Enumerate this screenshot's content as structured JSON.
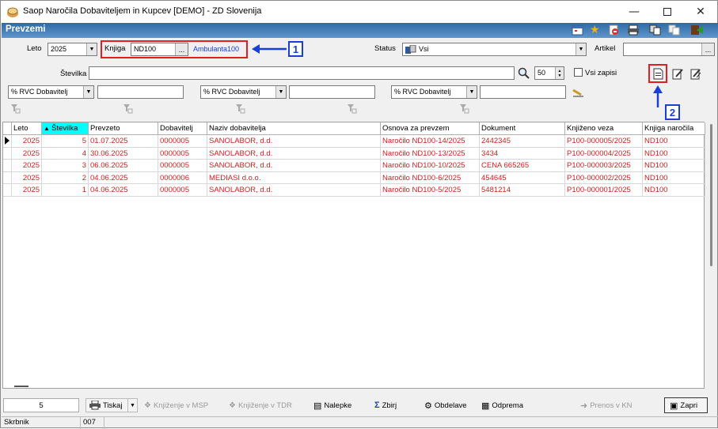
{
  "window": {
    "title": "Saop  Naročila Dobaviteljem in Kupcev [DEMO] - ZD Slovenija"
  },
  "header": {
    "title": "Prevzemi"
  },
  "filters": {
    "leto_label": "Leto",
    "leto_value": "2025",
    "knjiga_label": "Knjiga",
    "knjiga_value": "ND100",
    "knjiga_desc": "Ambulanta100",
    "status_label": "Status",
    "status_value": "Vsi",
    "artikel_label": "Artikel",
    "artikel_value": "",
    "stevilka_label": "Številka",
    "stevilka_value": "",
    "limit_value": "50",
    "vsi_zapisi_label": "Vsi zapisi",
    "rvc1": "% RVC Dobavitelj",
    "rvc2": "% RVC Dobavitelj",
    "rvc3": "% RVC Dobavitelj",
    "more_btn": "...",
    "callout1": "1",
    "callout2": "2"
  },
  "table": {
    "columns": [
      "Leto",
      "Številka",
      "Prevzeto",
      "Dobavitelj",
      "Naziv dobavitelja",
      "Osnova za prevzem",
      "Dokument",
      "Knjiženo veza",
      "Knjiga naročila"
    ],
    "rows": [
      [
        "2025",
        "5",
        "01.07.2025",
        "0000005",
        "SANOLABOR, d.d.",
        "Naročilo ND100-14/2025",
        "2442345",
        "P100-000005/2025",
        "ND100"
      ],
      [
        "2025",
        "4",
        "30.06.2025",
        "0000005",
        "SANOLABOR, d.d.",
        "Naročilo ND100-13/2025",
        "3434",
        "P100-000004/2025",
        "ND100"
      ],
      [
        "2025",
        "3",
        "06.06.2025",
        "0000005",
        "SANOLABOR, d.d.",
        "Naročilo ND100-10/2025",
        "CENA 665265",
        "P100-000003/2025",
        "ND100"
      ],
      [
        "2025",
        "2",
        "04.06.2025",
        "0000006",
        "MEDIASI d.o.o.",
        "Naročilo ND100-6/2025",
        "454645",
        "P100-000002/2025",
        "ND100"
      ],
      [
        "2025",
        "1",
        "04.06.2025",
        "0000005",
        "SANOLABOR, d.d.",
        "Naročilo ND100-5/2025",
        "5481214",
        "P100-000001/2025",
        "ND100"
      ]
    ]
  },
  "bottom": {
    "count": "5",
    "tiskaj": "Tiskaj",
    "knjizenje_msp": "Knjiženje v MSP",
    "knjizenje_tdr": "Knjiženje v TDR",
    "nalepke": "Nalepke",
    "zbirj": "Zbirj",
    "obdelave": "Obdelave",
    "odprema": "Odprema",
    "prenos": "Prenos v KN",
    "zapri": "Zapri"
  },
  "statusbar": {
    "user": "Skrbnik",
    "code": "007"
  },
  "colors": {
    "header": "#2f6aa5",
    "row_text": "#d42020",
    "callout": "#1a3fd6",
    "highlight": "#e02020",
    "sort_col": "#00ffff"
  }
}
